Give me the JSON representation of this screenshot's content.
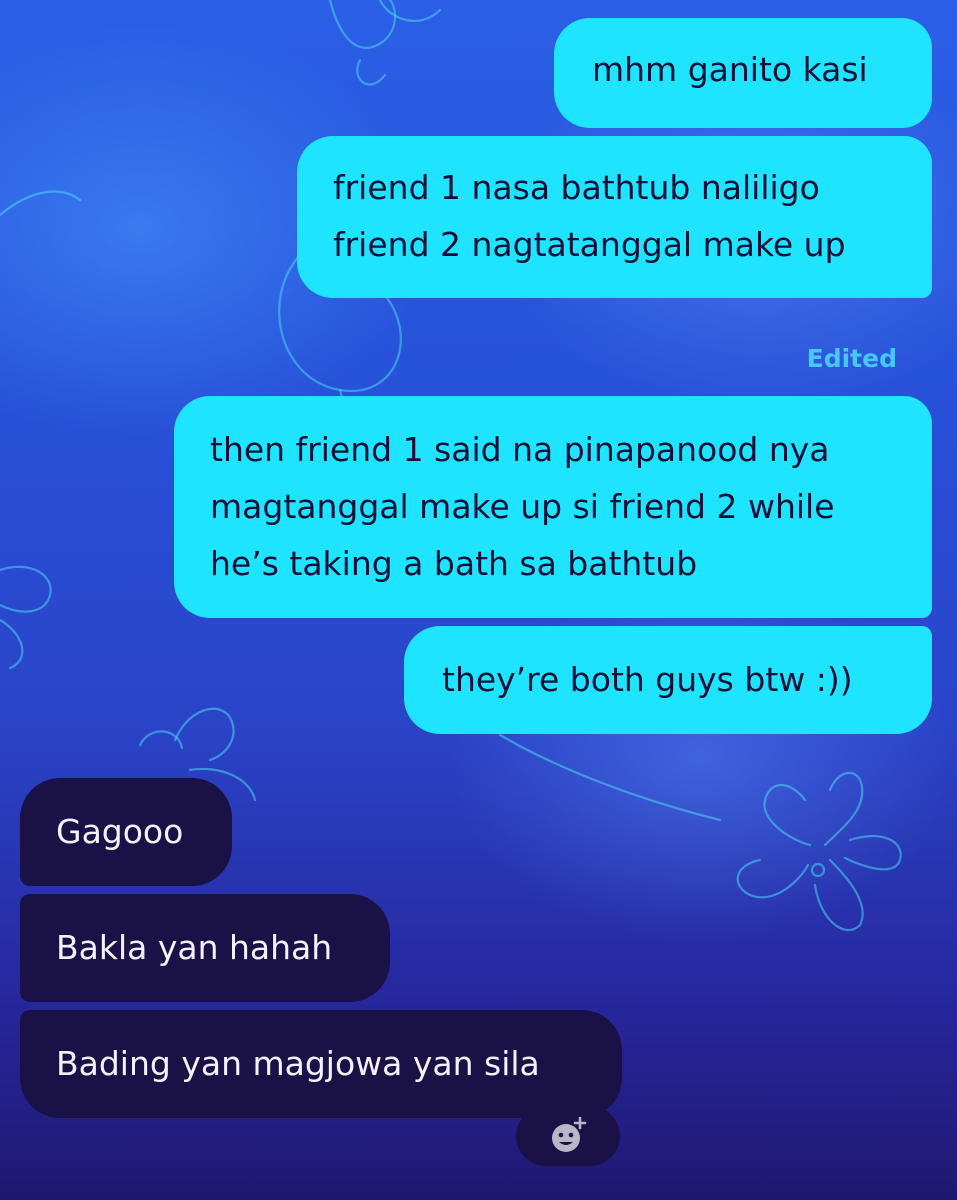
{
  "messages": [
    {
      "direction": "sent",
      "text": "mhm ganito kasi"
    },
    {
      "direction": "sent",
      "lines": [
        "friend 1 nasa bathtub naliligo",
        "friend 2 nagtatanggal make up"
      ]
    },
    {
      "direction": "sent",
      "edited_label": "Edited",
      "lines": [
        "then friend 1 said na pinapanood nya",
        "magtanggal make up si friend 2 while",
        "he’s taking a bath sa bathtub"
      ]
    },
    {
      "direction": "sent",
      "text": "they’re both guys btw :))"
    },
    {
      "direction": "received",
      "text": "Gagooo"
    },
    {
      "direction": "received",
      "text": "Bakla yan hahah"
    },
    {
      "direction": "received",
      "text": "Bading yan magjowa yan sila"
    }
  ],
  "reaction_button": {
    "icon": "add-reaction-icon"
  },
  "colors": {
    "sent_bubble": "#1fe4ff",
    "sent_text": "#151038",
    "received_bubble": "#1a1146",
    "received_text": "#f4f2ff",
    "edited_label": "#44c8f4",
    "background_top": "#2a5fe6",
    "background_bottom": "#1f1870"
  }
}
